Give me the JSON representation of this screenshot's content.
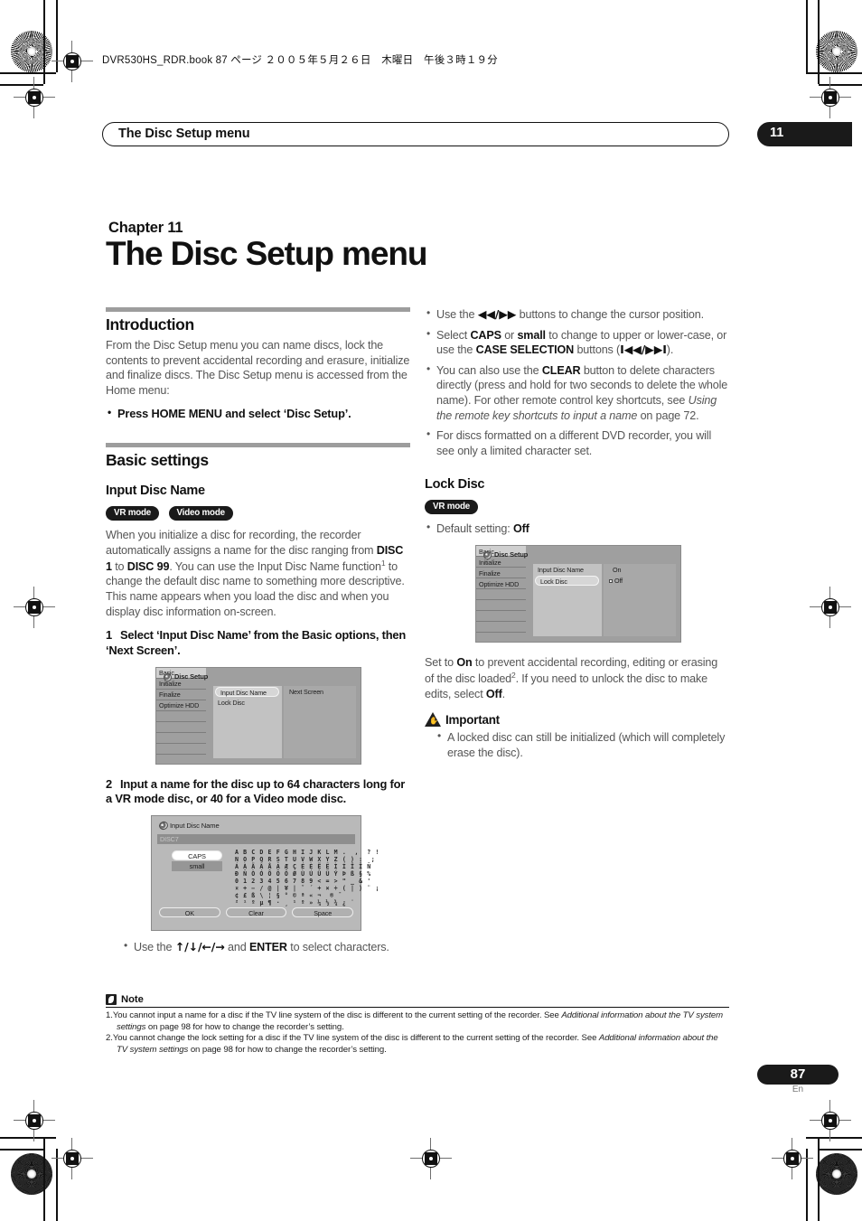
{
  "print_header": {
    "book_line": "DVR530HS_RDR.book  87 ページ  ２００５年５月２６日　木曜日　午後３時１９分"
  },
  "running_head": {
    "title": "The Disc Setup menu",
    "chapter_number": "11"
  },
  "chapter": {
    "label": "Chapter 11",
    "title": "The Disc Setup menu"
  },
  "left_column": {
    "introduction": {
      "heading": "Introduction",
      "paragraph": "From the Disc Setup menu you can name discs, lock the contents to prevent accidental recording and erasure, initialize and finalize discs. The Disc Setup menu is accessed from the Home menu:",
      "bullet": "Press HOME MENU and select ‘Disc Setup’."
    },
    "basic_settings": {
      "heading": "Basic settings",
      "input_disc_name": {
        "heading": "Input Disc Name",
        "badges": [
          "VR mode",
          "Video mode"
        ],
        "paragraph_1": "When you initialize a disc for recording, the recorder automatically assigns a name for the disc ranging from ",
        "disc_from": "DISC 1",
        "paragraph_2": " to ",
        "disc_to": "DISC 99",
        "paragraph_3": ". You can use the Input Disc Name function",
        "footnote_ref_1": "1",
        "paragraph_4": " to change the default disc name to something more descriptive. This name appears when you load the disc and when you display disc information on-screen.",
        "step1_num": "1",
        "step1_text": "Select ‘Input Disc Name’ from the Basic options, then ‘Next Screen’.",
        "step2_num": "2",
        "step2_text": "Input a name for the disc up to 64 characters long for a VR mode disc, or 40 for a Video mode disc.",
        "keyboard_bullet_pre": "Use the ",
        "keyboard_bullet_arrows": "↑/↓/←/→",
        "keyboard_bullet_mid": " and ",
        "keyboard_bullet_key": "ENTER",
        "keyboard_bullet_post": " to select characters."
      }
    }
  },
  "right_column": {
    "bullets": [
      {
        "pre": "Use the ",
        "keys": "◀◀/▶▶",
        "post": " buttons to change the cursor position."
      },
      {
        "pre": "Select ",
        "bold1": "CAPS",
        "mid1": " or ",
        "bold2": "small",
        "mid2": " to change to upper or lower-case, or use the ",
        "bold3": "CASE SELECTION",
        "mid3": " buttons (",
        "keys": "I◀◀/▶▶I",
        "post": ")."
      },
      {
        "pre": "You can also use the ",
        "bold1": "CLEAR",
        "mid1": " button to delete characters directly (press and hold for two seconds to delete the whole name). For other remote control key shortcuts, see ",
        "italic": "Using the remote key shortcuts to input a name",
        "post": " on page 72."
      },
      {
        "pre": "For discs formatted on a different DVD recorder, you will see only a limited character set."
      }
    ],
    "lock_disc": {
      "heading": "Lock Disc",
      "badges": [
        "VR mode"
      ],
      "default_label": "Default setting: ",
      "default_value": "Off",
      "paragraph_pre": "Set to ",
      "paragraph_on": "On",
      "paragraph_mid": " to prevent accidental recording, editing or erasing of the disc loaded",
      "footnote_ref_2": "2",
      "paragraph_post": ". If you need to unlock the disc to make edits, select ",
      "paragraph_off": "Off",
      "paragraph_end": "."
    },
    "important": {
      "heading": "Important",
      "bullet": "A locked disc can still be initialized (which will completely erase the disc)."
    }
  },
  "osd_screen_1": {
    "title": "Disc Setup",
    "menu_items": [
      "Basic",
      "Initialize",
      "Finalize",
      "Optimize HDD"
    ],
    "selected_menu": "Basic",
    "options": [
      "Input Disc Name",
      "Lock Disc"
    ],
    "selected_option": "Input Disc Name",
    "values": [
      "Next Screen"
    ]
  },
  "osd_screen_2": {
    "title": "Disc Setup",
    "menu_items": [
      "Basic",
      "Initialize",
      "Finalize",
      "Optimize HDD"
    ],
    "selected_menu": "Basic",
    "options": [
      "Input Disc Name",
      "Lock Disc"
    ],
    "selected_option": "Lock Disc",
    "values": [
      "On",
      "Off"
    ],
    "selected_value": "Off"
  },
  "osd_keyboard": {
    "title": "Input Disc Name",
    "name_field": "DISC7",
    "case_options": [
      "CAPS",
      "small"
    ],
    "selected_case": "small",
    "char_rows": [
      "A B C D E F G H I J K L M .  ,  ? !",
      "N O P Q R S T U V W X Y Z ( ) :  ;",
      "Á À Ä Â Å Ã Æ Ç É È Ë Ê Ì Í Ï Î Ñ",
      "Ð Ñ Ò Ó Ô Õ Ö Ø Ù Ú Û Ü Ý Þ ß § %",
      "0 1 2 3 4 5 6 7 8 9 < = > \" _ & '",
      "¤ + − / @ | ¥ | ˇ ´ + × ÷ ( | ) ¨ ¡",
      "¢ £ ß \\ ¦ § ° © ª « ¬ ­ ® ¯",
      "² ¹ º µ ¶ · ¸ ¹ º » ¼ ½ ¾ ¿ ˙"
    ],
    "buttons": [
      "OK",
      "Clear",
      "Space"
    ]
  },
  "notes": {
    "heading": "Note",
    "items": [
      {
        "num": "1.",
        "pre": "You cannot input a name for a disc if the TV line system of the disc is different to the current setting of the recorder. See ",
        "italic": "Additional information about the TV system settings",
        "post": " on page 98 for how to change the recorder’s setting."
      },
      {
        "num": "2.",
        "pre": "You cannot change the lock setting for a disc if the TV line system of the disc is different to the current setting of the recorder. See ",
        "italic": "Additional information about the TV system settings",
        "post": " on page 98 for how to change the recorder’s setting."
      }
    ]
  },
  "page_footer": {
    "number": "87",
    "language": "En"
  },
  "colors": {
    "accent_black": "#1a1a1a",
    "body_gray": "#555555",
    "rule_gray": "#9d9d9d",
    "osd_bg": "#9f9f9f"
  }
}
